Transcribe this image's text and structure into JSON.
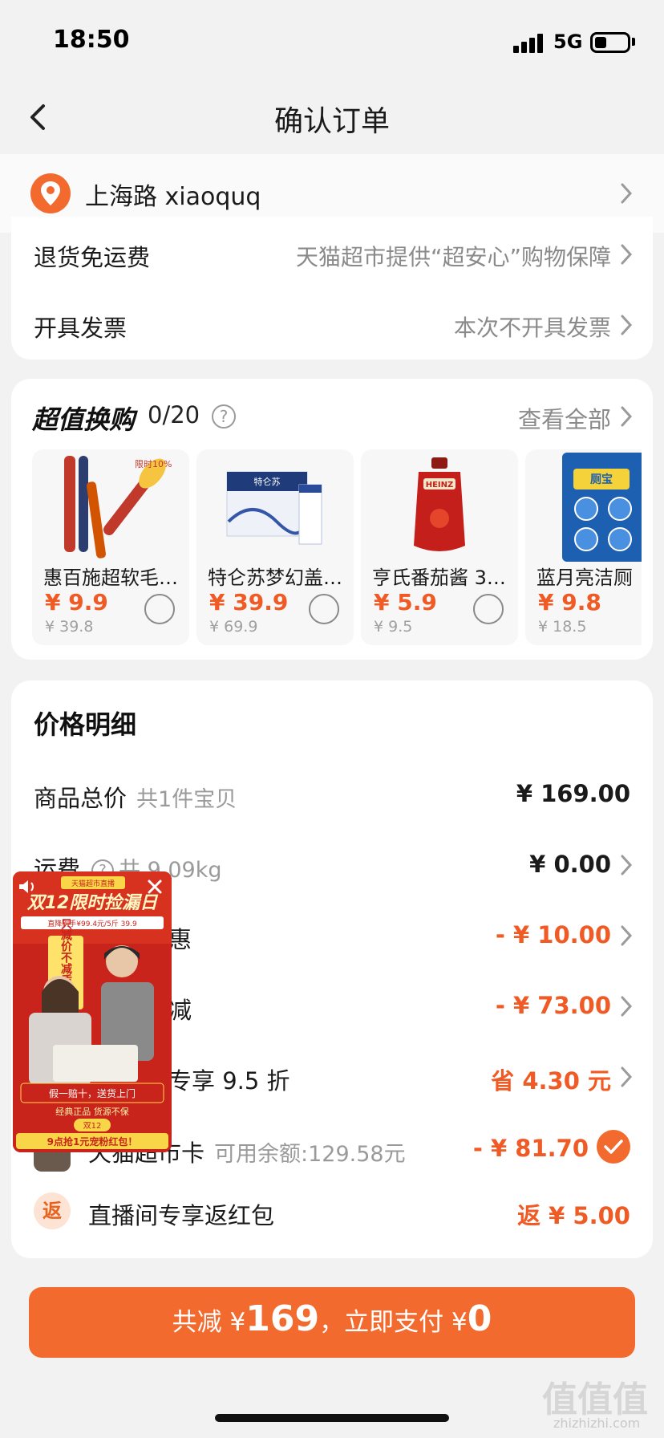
{
  "status_bar": {
    "time": "18:50",
    "network": "5G"
  },
  "nav": {
    "title": "确认订单"
  },
  "address": {
    "text": "上海路 xiaoquq"
  },
  "service_rows": [
    {
      "label": "退货免运费",
      "value": "天猫超市提供“超安心”购物保障"
    },
    {
      "label": "开具发票",
      "value": "本次不开具发票"
    }
  ],
  "swap": {
    "title": "超值换购",
    "count": "0/20",
    "help": "?",
    "view_all": "查看全部",
    "products": [
      {
        "name": "惠百施超软毛…",
        "price": "¥ 9.9",
        "original": "¥ 39.8",
        "img_text": "限时10%"
      },
      {
        "name": "特仑苏梦幻盖 …",
        "price": "¥ 39.9",
        "original": "¥ 69.9",
        "img_text": "特仑苏"
      },
      {
        "name": "亨氏番茄酱 32…",
        "price": "¥ 5.9",
        "original": "¥ 9.5",
        "img_text": "HEINZ"
      },
      {
        "name": "蓝月亮洁厕",
        "price": "¥ 9.8",
        "original": "¥ 18.5",
        "img_text": "厕宝"
      }
    ]
  },
  "price_detail": {
    "title": "价格明细",
    "total": {
      "label": "商品总价",
      "sub": "共1件宝贝",
      "value": "¥ 169.00"
    },
    "shipping": {
      "label": "运费",
      "sub": "共 9.09kg",
      "value": "¥ 0.00"
    },
    "discount1": {
      "label_visible": "惠",
      "value": "- ¥ 10.00"
    },
    "discount2": {
      "label_visible": "减",
      "value": "- ¥ 73.00"
    },
    "discount3": {
      "label_visible": "专享 9.5 折",
      "value": "省 4.30 元"
    },
    "card": {
      "label": "天猫超市卡",
      "sub": "可用余额:129.58元",
      "value": "- ¥ 81.70"
    },
    "redpacket": {
      "badge": "返",
      "label": "直播间专享返红包",
      "value": "返 ¥ 5.00"
    }
  },
  "live_float": {
    "brand": "天猫超市直播",
    "headline": "双12限时捡漏日",
    "sub": "直降到手¥99.4元/5斤 39.9",
    "banner1": "假一赔十，送货上门",
    "banner2": "经典正品 货源不保",
    "footer": "9点抢1元宠粉红包！",
    "tag": "双12",
    "side_text": "只减价不减质"
  },
  "pay": {
    "prefix": "共减 ¥",
    "saved": "169",
    "middle": "，立即支付 ¥",
    "amount": "0"
  },
  "watermark": {
    "text": "值值值",
    "sub": "zhizhizhi.com"
  }
}
